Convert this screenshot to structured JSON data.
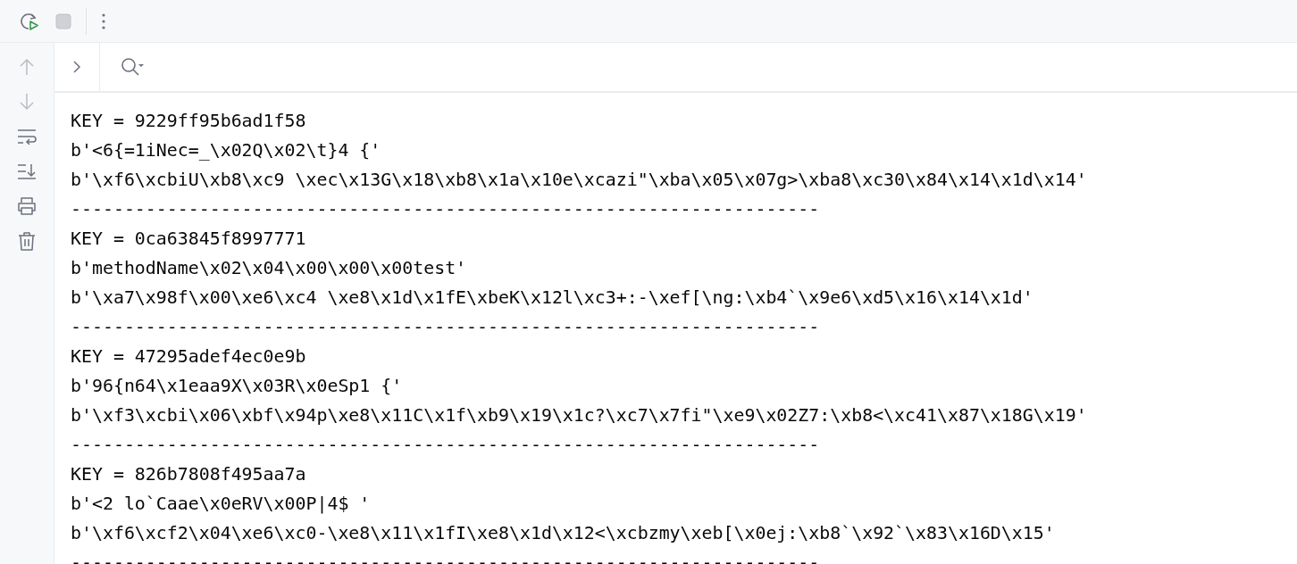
{
  "run_toolbar": {
    "tools": [
      {
        "kind": "rerun",
        "disabled": false
      },
      {
        "kind": "stop",
        "disabled": true
      },
      {
        "kind": "more",
        "disabled": false
      }
    ]
  },
  "side_toolbar": {
    "tools": [
      {
        "kind": "up",
        "disabled": true
      },
      {
        "kind": "down",
        "disabled": true
      },
      {
        "kind": "wrap",
        "disabled": false
      },
      {
        "kind": "scroll-end",
        "disabled": false
      },
      {
        "kind": "print",
        "disabled": false
      },
      {
        "kind": "trash",
        "disabled": false
      }
    ]
  },
  "console_header": {
    "tools": [
      {
        "kind": "expand"
      },
      {
        "kind": "search"
      }
    ]
  },
  "console": {
    "lines": [
      "KEY = 9229ff95b6ad1f58",
      "b'<6{=1iNec=_\\x02Q\\x02\\t}4 {'",
      "b'\\xf6\\xcbiU\\xb8\\xc9 \\xec\\x13G\\x18\\xb8\\x1a\\x10e\\xcazi\"\\xba\\x05\\x07g>\\xba8\\xc30\\x84\\x14\\x1d\\x14'",
      "----------------------------------------------------------------------",
      "KEY = 0ca63845f8997771",
      "b'methodName\\x02\\x04\\x00\\x00\\x00test'",
      "b'\\xa7\\x98f\\x00\\xe6\\xc4 \\xe8\\x1d\\x1fE\\xbeK\\x12l\\xc3+:-\\xef[\\ng:\\xb4`\\x9e6\\xd5\\x16\\x14\\x1d'",
      "----------------------------------------------------------------------",
      "KEY = 47295adef4ec0e9b",
      "b'96{n64\\x1eaa9X\\x03R\\x0eSp1 {'",
      "b'\\xf3\\xcbi\\x06\\xbf\\x94p\\xe8\\x11C\\x1f\\xb9\\x19\\x1c?\\xc7\\x7fi\"\\xe9\\x02Z7:\\xb8<\\xc41\\x87\\x18G\\x19'",
      "----------------------------------------------------------------------",
      "KEY = 826b7808f495aa7a",
      "b'<2 lo`Caae\\x0eRV\\x00P|4$ '",
      "b'\\xf6\\xcf2\\x04\\xe6\\xc0-\\xe8\\x11\\x1fI\\xe8\\x1d\\x12<\\xcbzmy\\xeb[\\x0ej:\\xb8`\\x92`\\x83\\x16D\\x15'",
      "----------------------------------------------------------------------"
    ]
  }
}
